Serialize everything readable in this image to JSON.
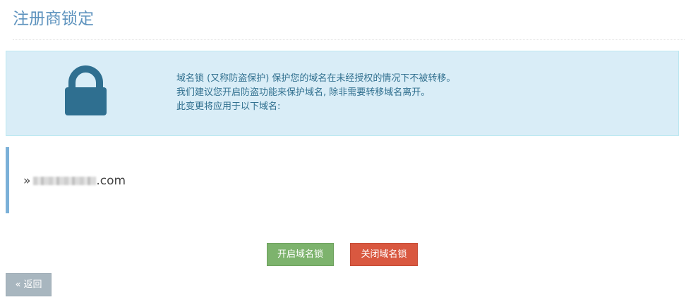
{
  "page": {
    "title": "注册商锁定"
  },
  "info": {
    "icon": "lock-icon",
    "lines": [
      "域名锁 (又称防盗保护) 保护您的域名在未经授权的情况下不被转移。",
      "我们建议您开启防盗功能来保护域名, 除非需要转移域名离开。",
      "此变更将应用于以下域名:"
    ]
  },
  "domain": {
    "prefix": "»",
    "suffix": ".com"
  },
  "actions": {
    "enable_label": "开启域名锁",
    "disable_label": "关闭域名锁"
  },
  "back": {
    "label": "« 返回"
  },
  "colors": {
    "title": "#5e93be",
    "info_bg": "#d9edf7",
    "info_border": "#bce8f1",
    "info_text": "#31708f",
    "lock": "#2f6f90",
    "quote": "#7bb0d8",
    "success": "#7db36d",
    "danger": "#d95840",
    "neutral": "#a8b6bf"
  }
}
